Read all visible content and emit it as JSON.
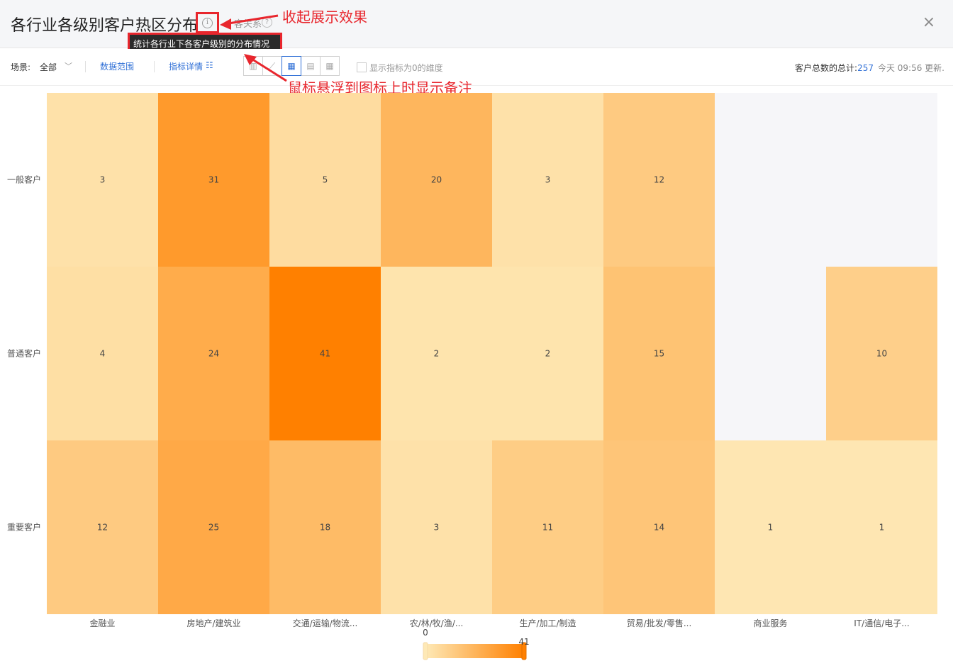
{
  "header": {
    "title": "各行业各级别客户热区分布",
    "hidden_label": "客关系",
    "close_label": "×"
  },
  "annotations": {
    "collapse_effect": "收起展示效果",
    "hover_note": "鼠标悬浮到图标上时显示备注"
  },
  "tooltip": {
    "text": "统计各行业下各客户级别的分布情况"
  },
  "toolbar": {
    "scene_label": "场景:",
    "scene_value": "全部",
    "data_range": "数据范围",
    "metric_detail": "指标详情",
    "view_types": [
      {
        "icon": "bar-chart-icon",
        "active": false
      },
      {
        "icon": "line-chart-icon",
        "active": false
      },
      {
        "icon": "heatmap-icon",
        "active": true
      },
      {
        "icon": "pivot-table-icon",
        "active": false
      },
      {
        "icon": "table-icon",
        "active": false
      }
    ],
    "show_zero_label": "显示指标为0的维度",
    "total_label": "客户总数的总计:",
    "total_value": "257",
    "updated_label": "今天 09:56 更新."
  },
  "chart_data": {
    "type": "heatmap",
    "x_categories": [
      "金融业",
      "房地产/建筑业",
      "交通/运输/物流...",
      "农/林/牧/渔/...",
      "生产/加工/制造",
      "贸易/批发/零售...",
      "商业服务",
      "IT/通信/电子..."
    ],
    "y_categories": [
      "一般客户",
      "普通客户",
      "重要客户"
    ],
    "values": [
      [
        3,
        31,
        5,
        20,
        3,
        12,
        null,
        null
      ],
      [
        4,
        24,
        41,
        2,
        2,
        15,
        null,
        10
      ],
      [
        12,
        25,
        18,
        3,
        11,
        14,
        1,
        1
      ]
    ],
    "visual_map": {
      "min": 0,
      "max": 41,
      "color_low": "#fee9b6",
      "color_high": "#ff8000"
    },
    "empty_color": "#f6f6f9"
  }
}
